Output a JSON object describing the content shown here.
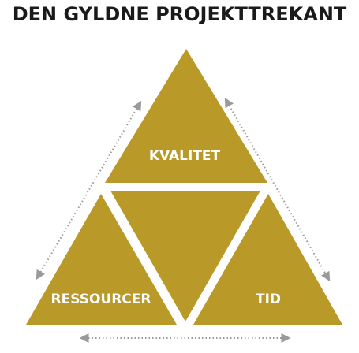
{
  "title": "DEN GYLDNE PROJEKTTREKANT",
  "triangles": {
    "top_label": "KVALITET",
    "bottom_left_label": "RESSOURCER",
    "bottom_right_label": "TID"
  },
  "colors": {
    "gold": "#b99a28",
    "arrow": "#9a9a9a",
    "title": "#1a1a1a",
    "label": "#ffffff"
  }
}
